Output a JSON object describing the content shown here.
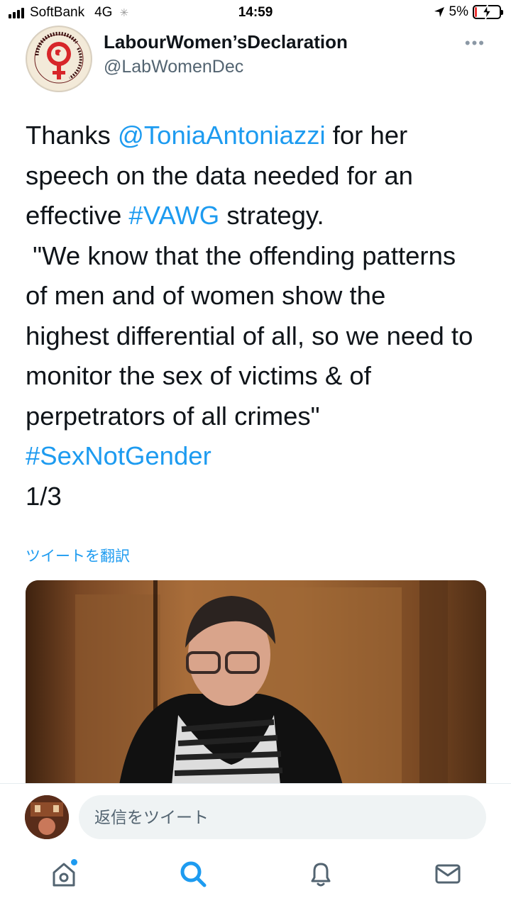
{
  "status_bar": {
    "carrier": "SoftBank",
    "network": "4G",
    "time": "14:59",
    "battery_percent": "5%",
    "icons": [
      "signal-bars-icon",
      "loading-spinner-icon",
      "location-arrow-icon",
      "battery-charging-icon"
    ]
  },
  "tweet": {
    "author_name": "LabourWomen’sDeclaration",
    "author_handle": "@LabWomenDec",
    "more_icon": "more-dots-icon",
    "lines": [
      [
        {
          "t": "Thanks "
        },
        {
          "t": "@ToniaAntoniazzi",
          "link": true
        },
        {
          "t": " for her"
        }
      ],
      [
        {
          "t": "speech on the data needed for an"
        }
      ],
      [
        {
          "t": "effective "
        },
        {
          "t": "#VAWG",
          "link": true
        },
        {
          "t": " strategy."
        }
      ],
      [
        {
          "t": " \"We know that the offending patterns"
        }
      ],
      [
        {
          "t": "of men and of women show the"
        }
      ],
      [
        {
          "t": "highest differential of all, so we need to"
        }
      ],
      [
        {
          "t": "monitor the sex of victims & of"
        }
      ],
      [
        {
          "t": "perpetrators of all crimes\""
        }
      ],
      [
        {
          "t": "#SexNotGender",
          "link": true
        }
      ],
      [
        {
          "t": "1/3"
        }
      ]
    ],
    "translate_label": "ツイートを翻訳"
  },
  "reply": {
    "placeholder": "返信をツイート"
  },
  "tab_bar": {
    "tabs": [
      "home-icon",
      "search-icon",
      "notifications-bell-icon",
      "messages-envelope-icon"
    ]
  },
  "colors": {
    "link": "#1d9bf0",
    "text": "#0f1419",
    "secondary": "#536471"
  }
}
